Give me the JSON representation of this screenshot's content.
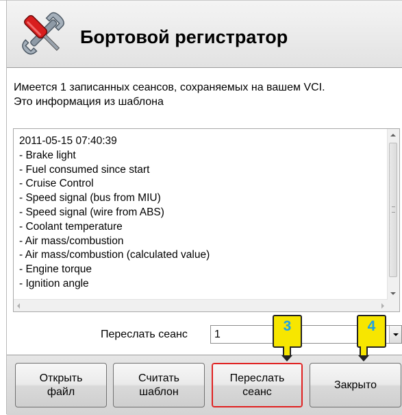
{
  "header": {
    "title": "Бортовой регистратор",
    "icon": "tools-icon"
  },
  "info": {
    "line1": "Имеется 1 записанных сеансов, сохраняемых на вашем VCI.",
    "line2": "Это информация из шаблона"
  },
  "list": {
    "lines": [
      "2011-05-15 07:40:39",
      "- Brake light",
      "- Fuel consumed since start",
      "- Cruise Control",
      "- Speed signal (bus from MIU)",
      "- Speed signal (wire from ABS)",
      "- Coolant temperature",
      "- Air mass/combustion",
      "- Air mass/combustion (calculated value)",
      "- Engine torque",
      "- Ignition angle"
    ]
  },
  "send_row": {
    "label": "Переслать сеанс",
    "selected_value": "1"
  },
  "buttons": {
    "open_file": "Открыть\nфайл",
    "read_template": "Считать\nшаблон",
    "send_session": "Переслать\nсеанс",
    "close": "Закрыто"
  },
  "callouts": {
    "c3": "3",
    "c4": "4",
    "color": "#f7e600",
    "number_color": "#1aa0e8"
  },
  "colors": {
    "highlight_border": "#e02020"
  }
}
